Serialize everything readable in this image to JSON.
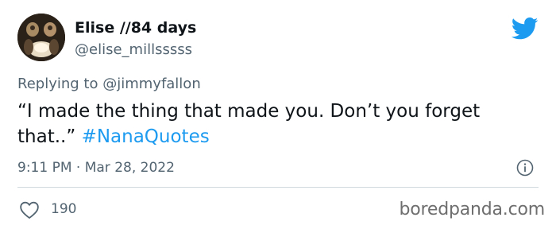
{
  "author": {
    "display_name": "Elise //84 days",
    "handle": "@elise_millsssss",
    "avatar_icon": "profile-photo"
  },
  "brand_icon": "twitter-bird-icon",
  "colors": {
    "accent": "#1d9bf0",
    "secondary_text": "#536471",
    "primary_text": "#0f1419",
    "divider": "#cfd9de"
  },
  "reply": {
    "prefix": "Replying to",
    "mention": "@jimmyfallon"
  },
  "tweet": {
    "text": "“I made the thing that made you. Don’t you forget that..”",
    "hashtag": "#NanaQuotes"
  },
  "meta": {
    "timestamp": "9:11 PM · Mar 28, 2022"
  },
  "footer": {
    "like_icon": "heart-outline-icon",
    "like_count": "190",
    "watermark": "boredpanda.com"
  }
}
